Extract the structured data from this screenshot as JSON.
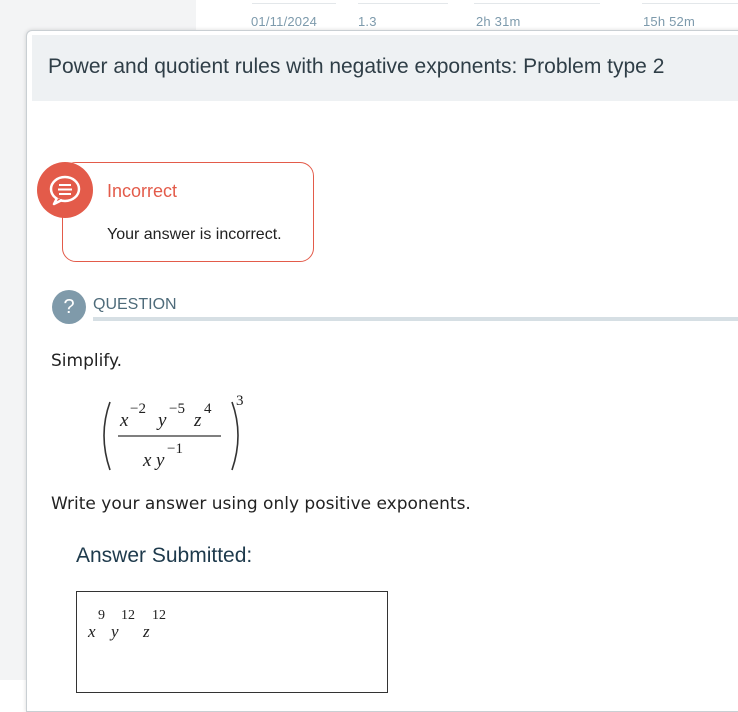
{
  "background_stats": [
    "01/11/2024",
    "1.3",
    "2h 31m",
    "15h 52m"
  ],
  "panel": {
    "title": "Power and quotient rules with negative exponents: Problem type 2"
  },
  "feedback": {
    "status": "Incorrect",
    "message": "Your answer is incorrect.",
    "color": "#e35b4a"
  },
  "question": {
    "icon_glyph": "?",
    "label": "QUESTION",
    "prompt": "Simplify.",
    "expression": {
      "numerator": [
        {
          "base": "x",
          "exp": "−2"
        },
        {
          "base": "y",
          "exp": "−5"
        },
        {
          "base": "z",
          "exp": "4"
        }
      ],
      "denominator": [
        {
          "base": "x",
          "exp": ""
        },
        {
          "base": "y",
          "exp": "−1"
        }
      ],
      "outer_exp": "3"
    },
    "instruction": "Write your answer using only positive exponents."
  },
  "answer": {
    "title": "Answer Submitted:",
    "terms": [
      {
        "base": "x",
        "exp": "9"
      },
      {
        "base": "y",
        "exp": "12"
      },
      {
        "base": "z",
        "exp": "12"
      }
    ]
  }
}
